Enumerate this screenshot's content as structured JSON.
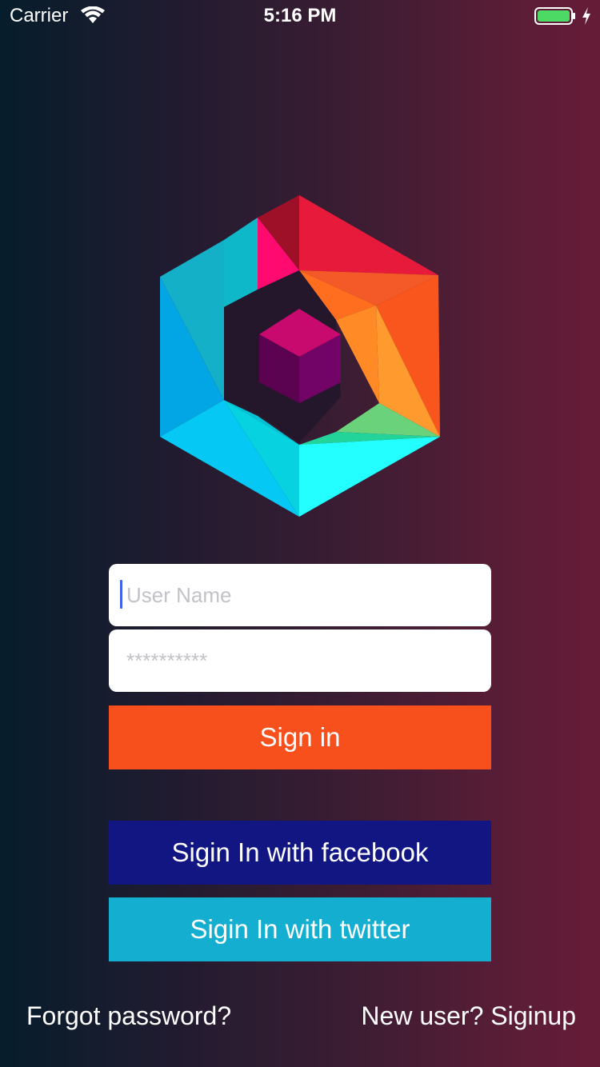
{
  "status_bar": {
    "carrier": "Carrier",
    "time": "5:16 PM",
    "battery_level": 1.0
  },
  "login": {
    "username_placeholder": "User Name",
    "username_value": "",
    "password_placeholder": "**********",
    "password_value": "",
    "signin_label": "Sign in",
    "facebook_label": "Sigin In with facebook",
    "twitter_label": "Sigin In with twitter",
    "forgot_label": "Forgot password?",
    "signup_label": "New user? Siginup"
  },
  "colors": {
    "signin": "#f8501d",
    "facebook": "#111683",
    "twitter": "#14aed0",
    "caret": "#3f63e6",
    "battery": "#4cd964"
  },
  "icons": {
    "wifi": "wifi-icon",
    "battery": "battery-icon",
    "charging": "charging-bolt-icon",
    "logo": "hexagon-b-logo"
  }
}
